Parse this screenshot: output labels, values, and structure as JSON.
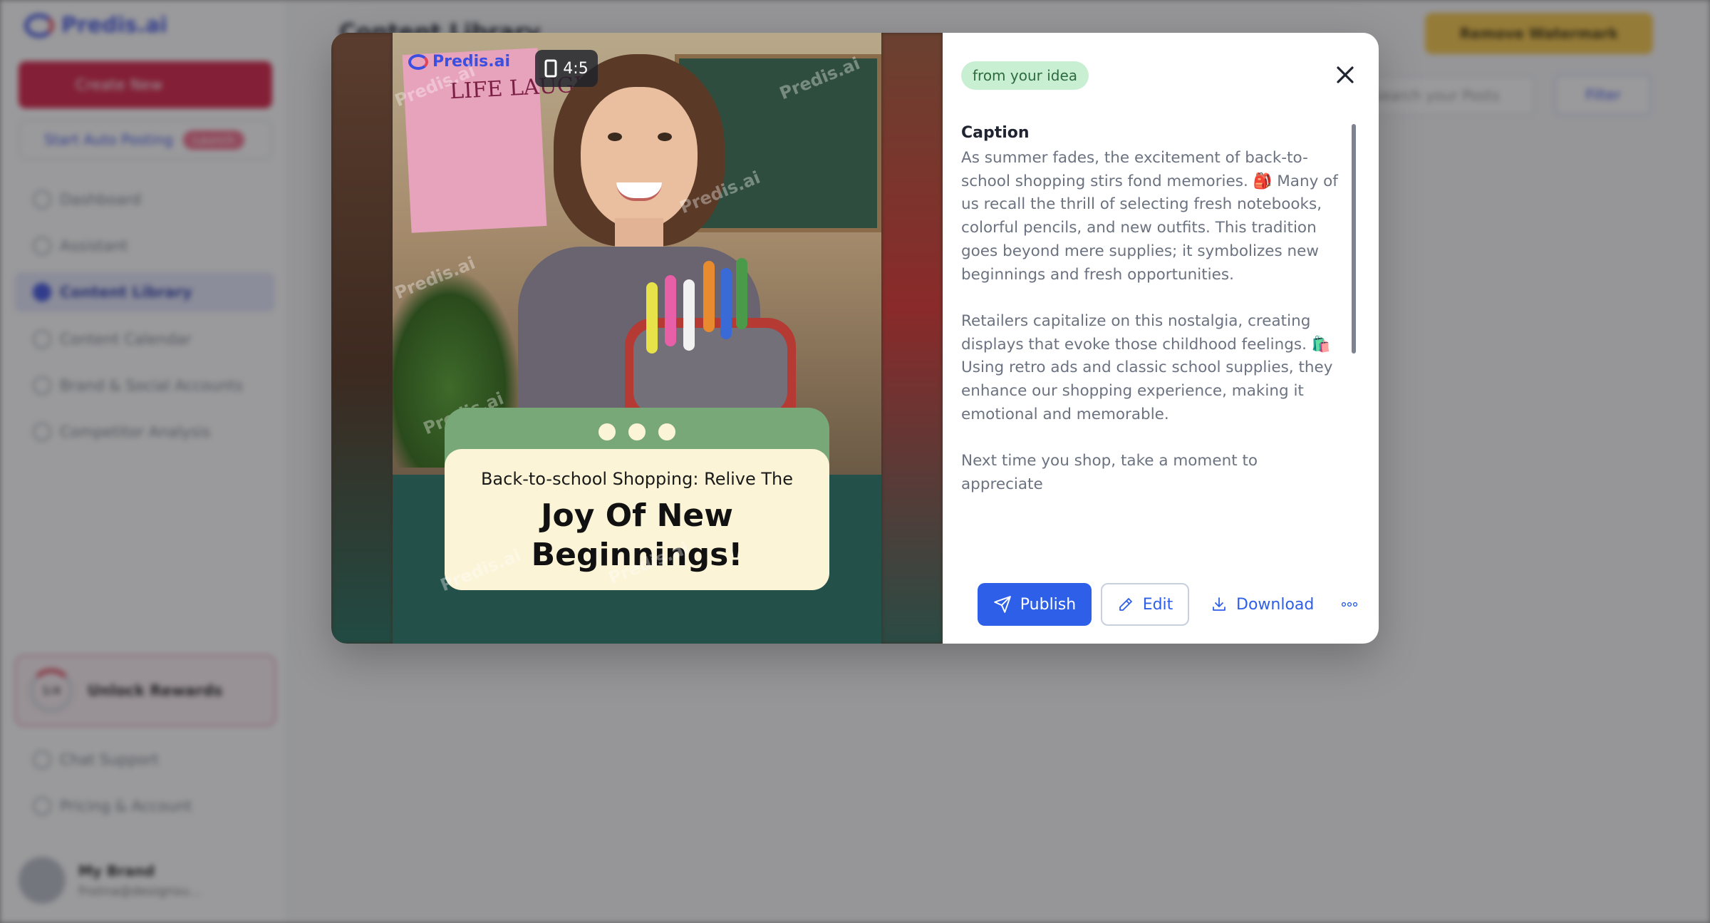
{
  "app": {
    "brand": "Predis.ai",
    "create_label": "Create New",
    "autopost_label": "Start Auto Posting",
    "autopost_badge": "Launch",
    "nav": [
      {
        "label": "Dashboard"
      },
      {
        "label": "Assistant"
      },
      {
        "label": "Content Library"
      },
      {
        "label": "Content Calendar"
      },
      {
        "label": "Brand & Social Accounts"
      },
      {
        "label": "Competitor Analysis"
      }
    ],
    "rewards": {
      "progress": "1/4",
      "label": "Unlock Rewards"
    },
    "support": [
      {
        "label": "Chat Support"
      },
      {
        "label": "Pricing & Account"
      }
    ],
    "profile": {
      "name": "My Brand",
      "email": "fnstna@designsu..."
    },
    "main_title": "Content Library",
    "watermark_button": "Remove Watermark",
    "search_placeholder": "Search your Posts",
    "filter_label": "Filter"
  },
  "modal": {
    "preview": {
      "brand": "Predis.ai",
      "aspect_ratio": "4:5",
      "watermark": "Predis.ai",
      "subtitle": "Back-to-school Shopping: Relive The",
      "title": "Joy Of New Beginnings!",
      "poster_text": "LIFE LAUGH",
      "colors": {
        "panel": "#24504a",
        "card": "#fbf4d7",
        "tab": "#78a878"
      }
    },
    "tag": "from your idea",
    "caption_label": "Caption",
    "caption": [
      "As summer fades, the excitement of back-to-school shopping stirs fond memories. 🎒 Many of us recall the thrill of selecting fresh notebooks, colorful pencils, and new outfits. This tradition goes beyond mere supplies; it symbolizes new beginnings and fresh opportunities.",
      "Retailers capitalize on this nostalgia, creating displays that evoke those childhood feelings. 🛍️ Using retro ads and classic school supplies, they enhance our shopping experience, making it emotional and memorable.",
      "Next time you shop, take a moment to appreciate"
    ],
    "actions": {
      "publish": "Publish",
      "edit": "Edit",
      "download": "Download"
    },
    "icons": {
      "close": "close-icon",
      "publish": "paper-plane-icon",
      "edit": "pencil-icon",
      "download": "download-icon",
      "more": "more-horizontal-icon"
    },
    "accent": "#2e5fe8"
  }
}
